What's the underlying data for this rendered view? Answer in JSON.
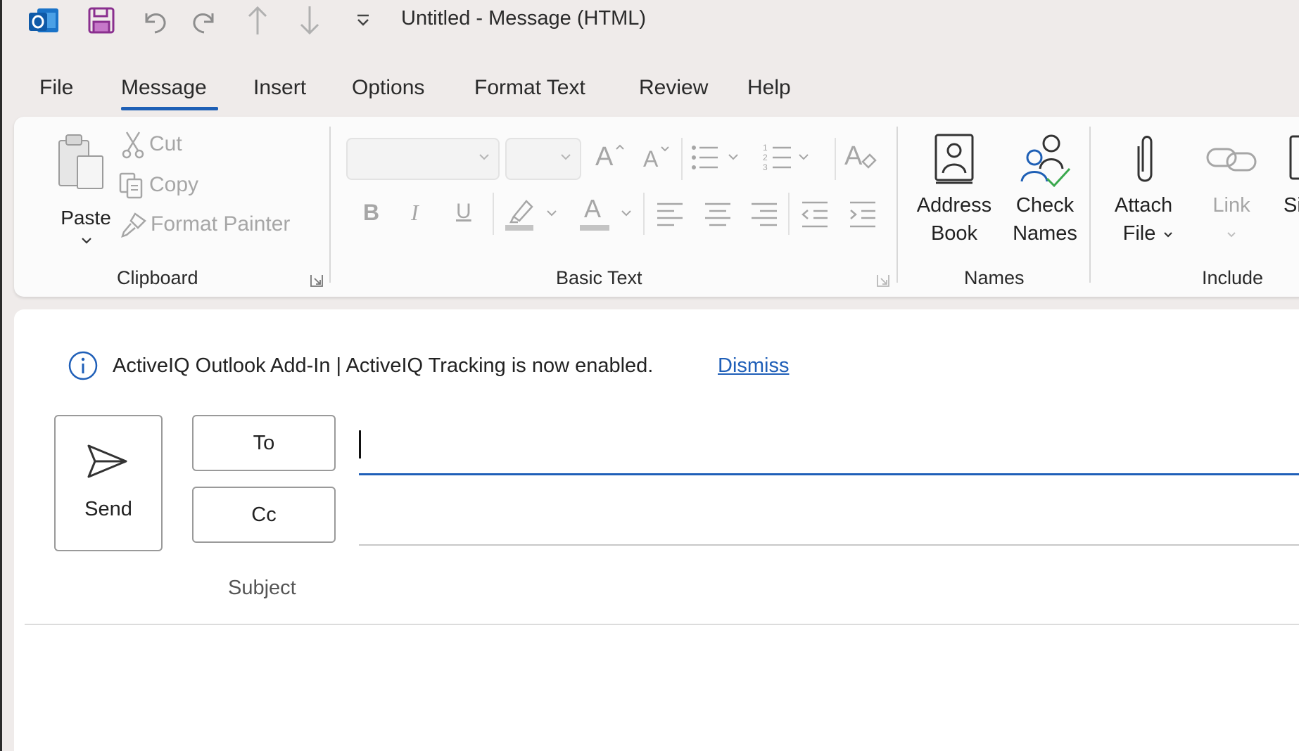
{
  "window": {
    "title": "Untitled  -  Message (HTML)"
  },
  "quick_access": [
    {
      "name": "outlook-app-icon"
    },
    {
      "name": "save-icon"
    },
    {
      "name": "undo-icon"
    },
    {
      "name": "redo-icon"
    },
    {
      "name": "previous-item-icon"
    },
    {
      "name": "next-item-icon"
    },
    {
      "name": "customize-toolbar-icon"
    }
  ],
  "tabs": [
    {
      "label": "File"
    },
    {
      "label": "Message",
      "active": true
    },
    {
      "label": "Insert"
    },
    {
      "label": "Options"
    },
    {
      "label": "Format Text"
    },
    {
      "label": "Review"
    },
    {
      "label": "Help"
    }
  ],
  "ribbon": {
    "clipboard": {
      "paste_label": "Paste",
      "cut_label": "Cut",
      "copy_label": "Copy",
      "format_painter_label": "Format Painter",
      "group_label": "Clipboard"
    },
    "basic_text": {
      "font_name": "",
      "font_size": "",
      "group_label": "Basic Text",
      "bold_glyph": "B",
      "italic_glyph": "I",
      "underline_glyph": "U",
      "font_color_glyph": "A",
      "grow_font_glyph": "A",
      "shrink_font_glyph": "A"
    },
    "names": {
      "address_book_line1": "Address",
      "address_book_line2": "Book",
      "check_names_line1": "Check",
      "check_names_line2": "Names",
      "group_label": "Names"
    },
    "include": {
      "attach_file_line1": "Attach",
      "attach_file_line2": "File",
      "link_label": "Link",
      "signature_label": "Sig",
      "group_label": "Include"
    }
  },
  "infobar": {
    "text": "ActiveIQ Outlook Add-In  |  ActiveIQ Tracking is now enabled.",
    "dismiss_label": "Dismiss"
  },
  "compose": {
    "send_label": "Send",
    "to_label": "To",
    "cc_label": "Cc",
    "subject_label": "Subject",
    "to_value": "",
    "cc_value": "",
    "subject_value": ""
  },
  "colors": {
    "accent": "#1e5fb5",
    "save_icon": "#8a2f8f",
    "link": "#1f5fb8"
  }
}
